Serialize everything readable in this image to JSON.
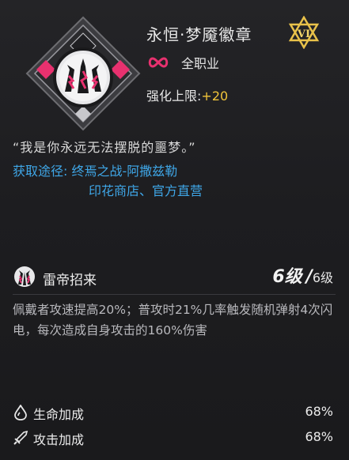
{
  "item": {
    "name": "永恒·梦魇徽章",
    "tier": "VI",
    "class_label": "全职业",
    "limit_label": "强化上限:",
    "limit_value": "+20",
    "quote": "“我是你永远无法摆脱的噩梦。”",
    "source_line1": "获取途径: 终焉之战-阿撒兹勒",
    "source_line2": "印花商店、官方直营"
  },
  "skill": {
    "name": "雷帝招来",
    "level_current": "6级",
    "level_sep": "/",
    "level_max": "6级",
    "description": "佩戴者攻速提高20%；普攻时21%几率触发随机弹射4次闪电，每次造成自身攻击的160%伤害"
  },
  "stats": [
    {
      "icon": "water-drop-icon",
      "label": "生命加成",
      "value": "68%"
    },
    {
      "icon": "sword-icon",
      "label": "攻击加成",
      "value": "68%"
    }
  ],
  "colors": {
    "accent_pink": "#e8316f",
    "source_blue": "#3fa7e8",
    "limit_gold": "#f0c43a"
  }
}
